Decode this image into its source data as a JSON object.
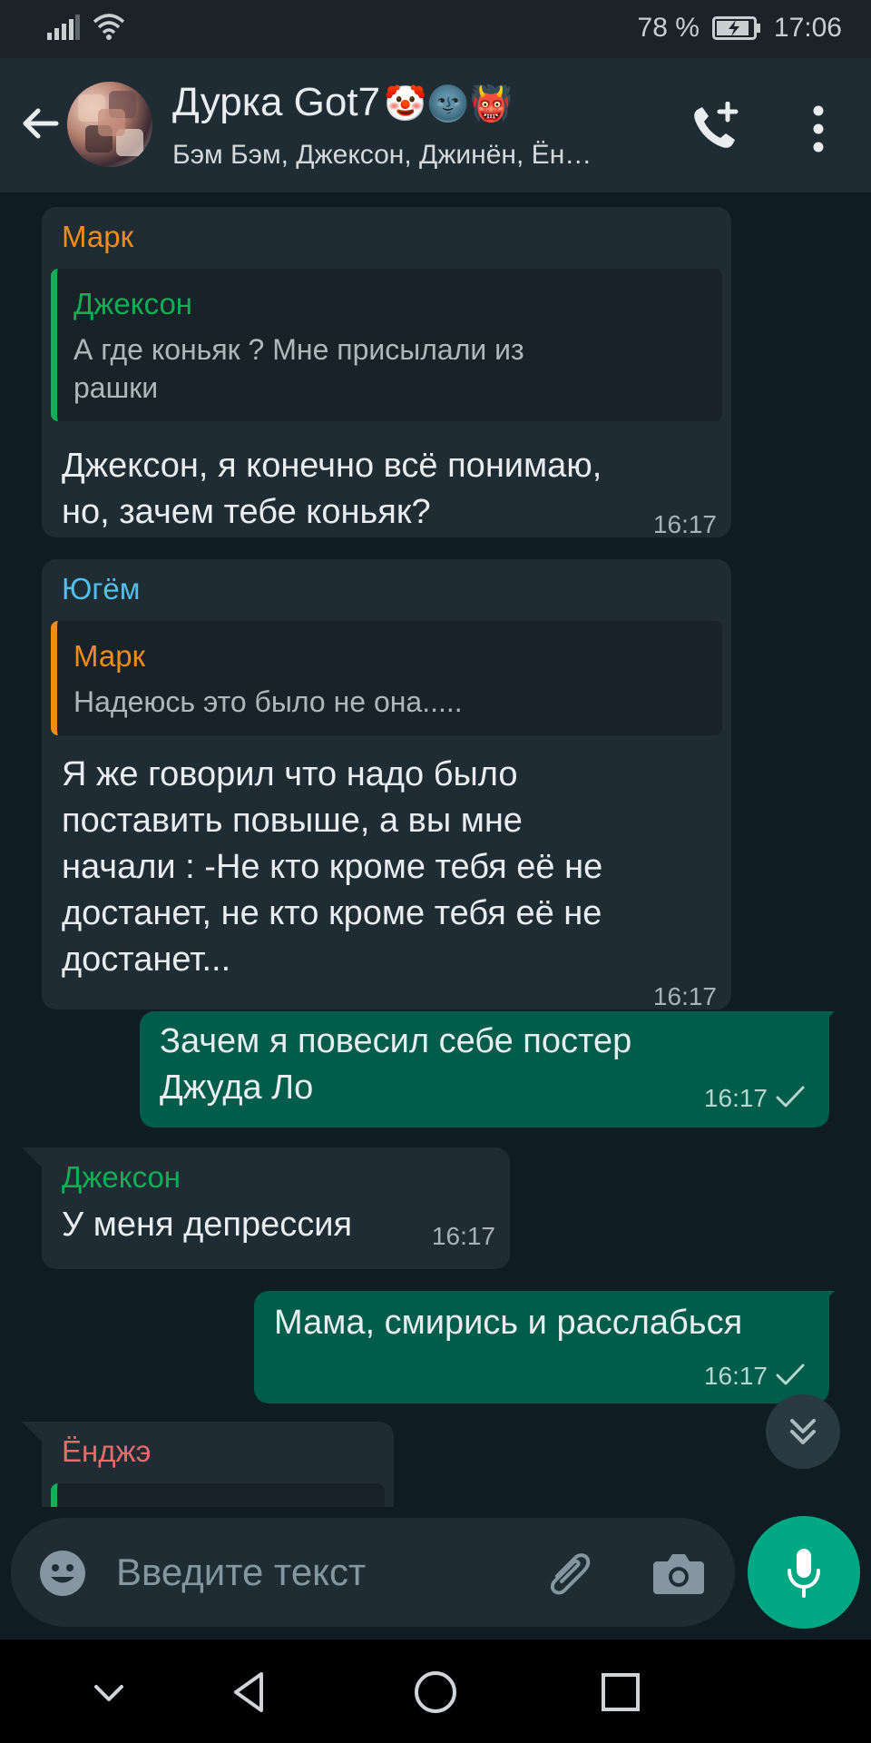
{
  "status": {
    "battery_percent": "78 %",
    "time": "17:06",
    "signal_level": 0.8,
    "wifi_level": 0.75
  },
  "header": {
    "title": "Дурка Got7",
    "title_emojis": "🤡🌚👹",
    "subtitle": "Бэм Бэм, Джексон, Джинён, Ён…",
    "icons": [
      "back-arrow-icon",
      "add-call-icon",
      "more-vert-icon"
    ]
  },
  "messages": [
    {
      "direction": "in",
      "sender": "Марк",
      "sender_color": "#f18c1c",
      "quote": {
        "name": "Джексон",
        "name_color": "#13ad55",
        "bar_color": "#13ad55",
        "text": "А где коньяк ? Мне присылали из\nрашки"
      },
      "text": "Джексон, я конечно всё понимаю,\nно, зачем тебе коньяк?",
      "time": "16:17"
    },
    {
      "direction": "in",
      "sender": "Югём",
      "sender_color": "#53bdeb",
      "quote": {
        "name": "Марк",
        "name_color": "#f18c1c",
        "bar_color": "#f18c1c",
        "text": "Надеюсь это было не она....."
      },
      "text": "Я же говорил что надо было\nпоставить повыше,  а вы мне\nначали : -Не кто кроме тебя её не\nдостанет,  не кто кроме тебя её не\nдостанет...",
      "time": "16:17"
    },
    {
      "direction": "out",
      "text": "Зачем я повесил себе постер\nДжуда Ло",
      "time": "16:17",
      "status_icon": "check-icon"
    },
    {
      "direction": "in",
      "sender": "Джексон",
      "sender_color": "#13ad55",
      "text": "У меня депрессия",
      "time": "16:17"
    },
    {
      "direction": "out",
      "text": "Мама, смирись и расслабься",
      "time": "16:17",
      "status_icon": "check-icon"
    },
    {
      "direction": "in",
      "sender": "Ёнджэ",
      "sender_color": "#e86a6a",
      "partial": true
    }
  ],
  "composer": {
    "placeholder": "Введите текст",
    "icons": [
      "emoji-icon",
      "paperclip-icon",
      "camera-icon",
      "mic-icon"
    ]
  },
  "colors": {
    "background": "#0f1c24",
    "bubble_in": "#1f2c34",
    "bubble_out": "#005c4b",
    "accent": "#00a884"
  }
}
